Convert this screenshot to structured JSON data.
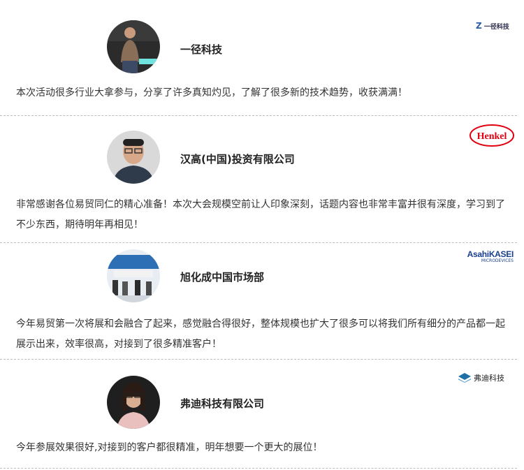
{
  "testimonials": [
    {
      "company": "一径科技",
      "quote": "本次活动很多行业大拿参与，分享了许多真知灼见，了解了很多新的技术趋势，收获满满！",
      "logo_text": "一径科技",
      "logo_mark": "Z"
    },
    {
      "company": "汉高(中国)投资有限公司",
      "quote": "非常感谢各位易贸同仁的精心准备！本次大会规模空前让人印象深刻，话题内容也非常丰富并很有深度，学习到了不少东西，期待明年再相见！",
      "logo_text": "Henkel"
    },
    {
      "company": "旭化成中国市场部",
      "quote": "今年易贸第一次将展和会融合了起来，感觉融合得很好，整体规模也扩大了很多可以将我们所有细分的产品都一起展示出来，效率很高，对接到了很多精准客户！",
      "logo_text": "AsahiKASEI",
      "logo_sub": "MICRODEVICES"
    },
    {
      "company": "弗迪科技有限公司",
      "quote": "今年参展效果很好,对接到的客户都很精准，明年想要一个更大的展位！",
      "logo_text": "弗迪科技"
    }
  ],
  "colors": {
    "text": "#333333",
    "henkel_red": "#e1000f",
    "asahi_blue": "#1a3f8f",
    "fudi_blue": "#1e6fa8",
    "separator": "#bdbdbd"
  }
}
